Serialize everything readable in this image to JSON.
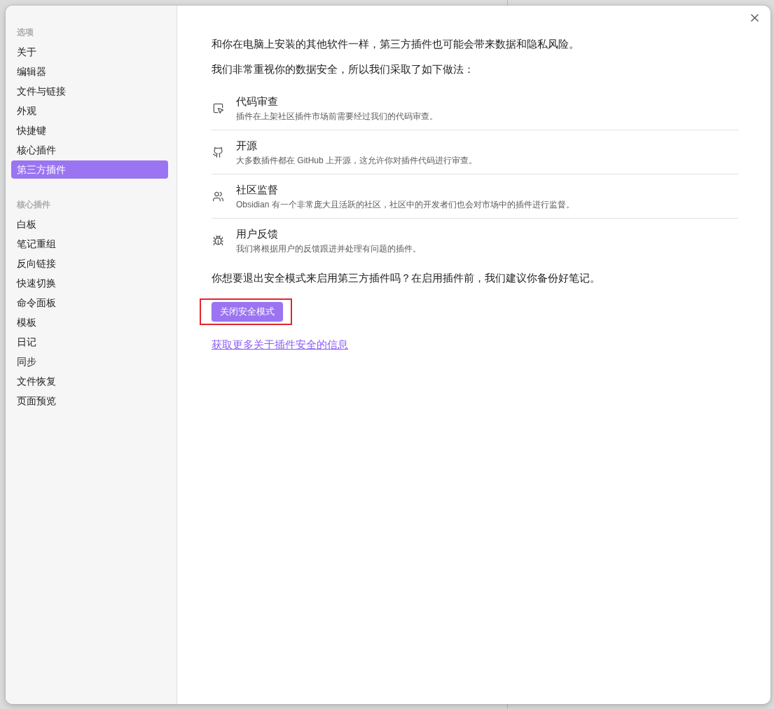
{
  "sidebar": {
    "sections": [
      {
        "heading": "选项",
        "items": [
          {
            "label": "关于",
            "selected": false
          },
          {
            "label": "编辑器",
            "selected": false
          },
          {
            "label": "文件与链接",
            "selected": false
          },
          {
            "label": "外观",
            "selected": false
          },
          {
            "label": "快捷键",
            "selected": false
          },
          {
            "label": "核心插件",
            "selected": false
          },
          {
            "label": "第三方插件",
            "selected": true
          }
        ]
      },
      {
        "heading": "核心插件",
        "items": [
          {
            "label": "白板",
            "selected": false
          },
          {
            "label": "笔记重组",
            "selected": false
          },
          {
            "label": "反向链接",
            "selected": false
          },
          {
            "label": "快速切换",
            "selected": false
          },
          {
            "label": "命令面板",
            "selected": false
          },
          {
            "label": "模板",
            "selected": false
          },
          {
            "label": "日记",
            "selected": false
          },
          {
            "label": "同步",
            "selected": false
          },
          {
            "label": "文件恢复",
            "selected": false
          },
          {
            "label": "页面预览",
            "selected": false
          }
        ]
      }
    ]
  },
  "content": {
    "paragraphs": [
      "和你在电脑上安装的其他软件一样，第三方插件也可能会带来数据和隐私风险。",
      "我们非常重视你的数据安全，所以我们采取了如下做法："
    ],
    "measures": [
      {
        "title": "代码审查",
        "description": "插件在上架社区插件市场前需要经过我们的代码审查。"
      },
      {
        "title": "开源",
        "description": "大多数插件都在 GitHub 上开源，这允许你对插件代码进行审查。"
      },
      {
        "title": "社区监督",
        "description": "Obsidian 有一个非常庞大且活跃的社区，社区中的开发者们也会对市场中的插件进行监督。"
      },
      {
        "title": "用户反馈",
        "description": "我们将根据用户的反馈跟进并处理有问题的插件。"
      }
    ],
    "question": "你想要退出安全模式来启用第三方插件吗？在启用插件前，我们建议你备份好笔记。",
    "confirm_button": {
      "label": "关闭安全模式",
      "highlighted": true
    },
    "link": "获取更多关于插件安全的信息"
  }
}
